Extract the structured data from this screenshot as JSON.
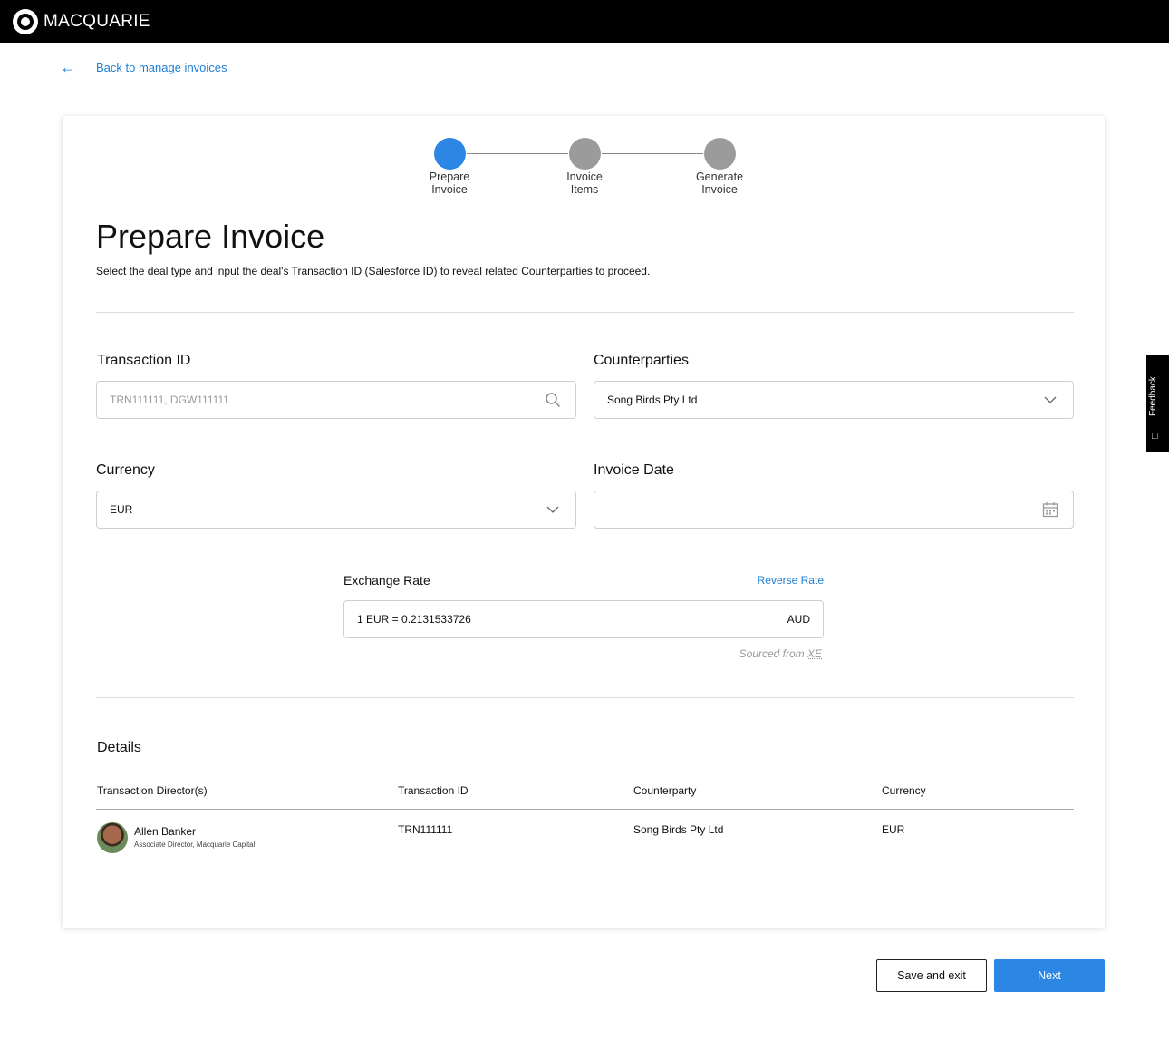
{
  "header": {
    "brand": "MACQUARIE"
  },
  "nav": {
    "back_label": "Back to manage invoices"
  },
  "stepper": {
    "steps": [
      {
        "line1": "Prepare",
        "line2": "Invoice",
        "state": "active"
      },
      {
        "line1": "Invoice",
        "line2": "Items",
        "state": "inactive"
      },
      {
        "line1": "Generate",
        "line2": "Invoice",
        "state": "inactive"
      }
    ]
  },
  "page": {
    "title": "Prepare Invoice",
    "subtitle": "Select the deal type and input the deal's Transaction ID (Salesforce ID) to reveal related Counterparties to proceed."
  },
  "form": {
    "transaction_id": {
      "label": "Transaction ID",
      "placeholder": "TRN111111, DGW111111",
      "value": ""
    },
    "counterparties": {
      "label": "Counterparties",
      "value": "Song Birds Pty Ltd"
    },
    "currency": {
      "label": "Currency",
      "value": "EUR"
    },
    "invoice_date": {
      "label": "Invoice Date",
      "value": ""
    },
    "exchange_rate": {
      "label": "Exchange Rate",
      "reverse_label": "Reverse Rate",
      "value": "1 EUR = 0.2131533726",
      "target_currency": "AUD",
      "source_prefix": "Sourced from",
      "source_name": "XE"
    }
  },
  "details": {
    "title": "Details",
    "columns": [
      "Transaction Director(s)",
      "Transaction ID",
      "Counterparty",
      "Currency"
    ],
    "rows": [
      {
        "director_name": "Allen Banker",
        "director_role": "Associate Director, Macquarie Capital",
        "transaction_id": "TRN111111",
        "counterparty": "Song Birds Pty Ltd",
        "currency": "EUR"
      }
    ]
  },
  "feedback": {
    "label": "Feedback"
  },
  "actions": {
    "save_label": "Save and exit",
    "next_label": "Next"
  },
  "colors": {
    "accent": "#2b87e3",
    "link": "#1e7fd4",
    "topbar": "#000000",
    "step_inactive": "#9b9b9b"
  }
}
